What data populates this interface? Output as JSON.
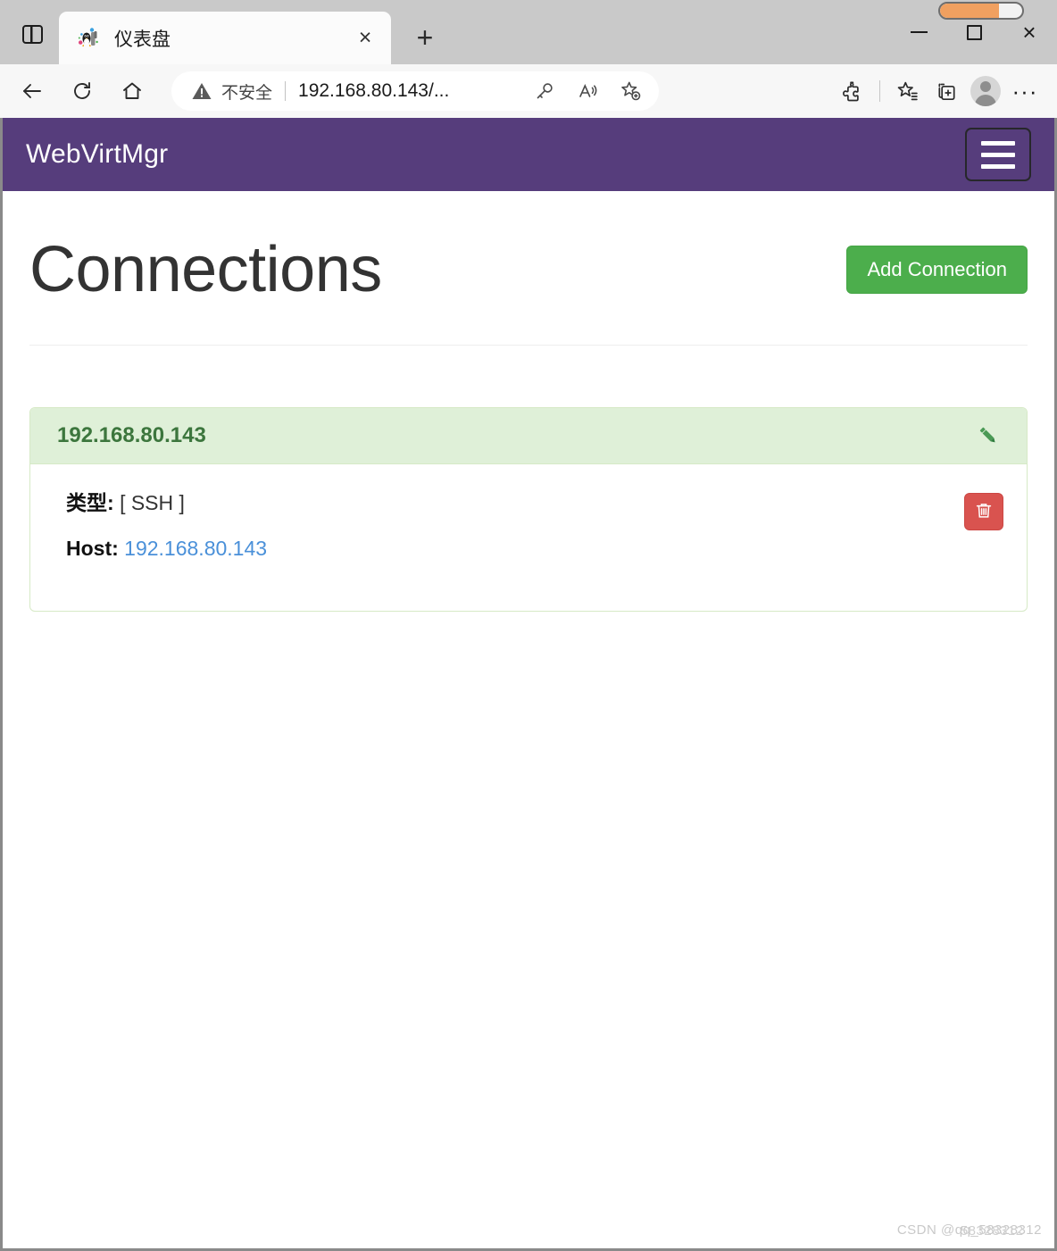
{
  "browser": {
    "tab": {
      "title": "仪表盘",
      "favicon": "linux-penguin-favicon",
      "close_label": "×"
    },
    "new_tab_label": "+",
    "window_controls": {
      "minimize": "minimize-icon",
      "maximize": "maximize-icon",
      "close": "×"
    },
    "nav": {
      "back": "back-arrow-icon",
      "refresh": "refresh-icon",
      "home": "home-icon"
    },
    "omnibox": {
      "security_icon": "warning-triangle-icon",
      "security_label": "不安全",
      "url": "192.168.80.143/...",
      "actions": [
        "key-icon",
        "read-aloud-icon",
        "add-favorite-icon"
      ]
    },
    "toolbar_right": [
      "extensions-icon",
      "favorites-icon",
      "collections-icon",
      "profile-avatar",
      "settings-more-icon"
    ],
    "progress": {
      "percent": 72,
      "color": "#f0a060"
    }
  },
  "app": {
    "navbar": {
      "brand": "WebVirtMgr",
      "brand_color": "#563d7c",
      "menu_toggle": "hamburger-menu-icon"
    },
    "page": {
      "title": "Connections",
      "add_button": "Add Connection",
      "add_button_color": "#4cae4c"
    },
    "connections": [
      {
        "name": "192.168.80.143",
        "header_color": "#dff0d8",
        "title_color": "#3c763d",
        "edit_icon": "pencil-edit-icon",
        "type_label": "类型:",
        "type_value": "[ SSH ]",
        "host_label": "Host:",
        "host_value": "192.168.80.143",
        "host_link_color": "#4a90d9",
        "delete_icon": "trash-delete-icon",
        "delete_color": "#d9534f"
      }
    ]
  },
  "watermark": {
    "text": "CSDN @qq_58328312",
    "overlay": "58328312"
  }
}
